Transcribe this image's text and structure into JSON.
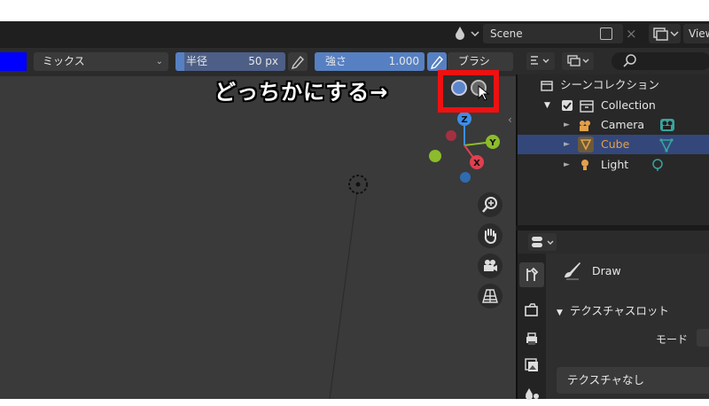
{
  "topbar": {
    "scene_name": "Scene",
    "close_glyph": "×",
    "view_layer": "View"
  },
  "tool_header": {
    "color_hex": "#0000ff",
    "blend_mode": "ミックス",
    "radius_label": "半径",
    "radius_value": "50 px",
    "strength_label": "強さ",
    "strength_value": "1.000",
    "strength_fraction": 1.0,
    "brush_menu": "ブラシ"
  },
  "viewport": {
    "annotation": "どっちかにする→"
  },
  "outliner": {
    "root": "シーンコレクション",
    "collection": "Collection",
    "items": [
      {
        "label": "Camera",
        "icon": "camera-icon",
        "color": "#e3a14a"
      },
      {
        "label": "Cube",
        "icon": "mesh-icon",
        "color": "#e3a14a"
      },
      {
        "label": "Light",
        "icon": "light-icon",
        "color": "#dddddd"
      }
    ]
  },
  "properties": {
    "tool_name": "Draw",
    "panel_title": "テクスチャスロット",
    "mode_label": "モード",
    "texture_value": "テクスチャなし"
  },
  "colors": {
    "axis_x": "#e04050",
    "axis_y": "#8cbc2c",
    "axis_z": "#3c8ee8",
    "selection": "#33477a",
    "highlight_box": "#ee1111"
  }
}
